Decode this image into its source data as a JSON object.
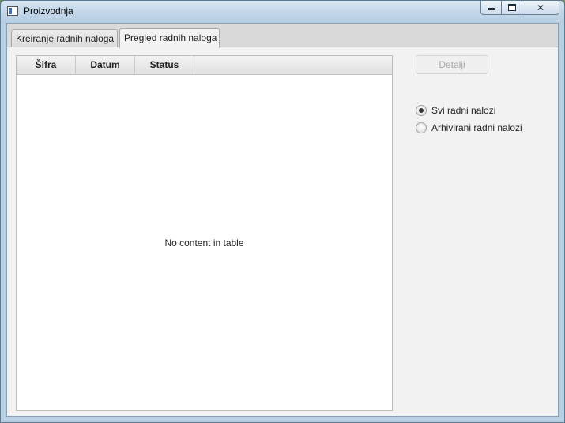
{
  "window": {
    "title": "Proizvodnja"
  },
  "tabs": [
    {
      "label": "Kreiranje radnih naloga",
      "selected": false
    },
    {
      "label": "Pregled radnih naloga",
      "selected": true
    }
  ],
  "table": {
    "columns": [
      "Šifra",
      "Datum",
      "Status"
    ],
    "rows": [],
    "empty_message": "No content in table"
  },
  "details_button": {
    "label": "Detalji",
    "enabled": false
  },
  "filter": {
    "options": [
      {
        "label": "Svi radni nalozi",
        "selected": true
      },
      {
        "label": "Arhivirani radni nalozi",
        "selected": false
      }
    ]
  },
  "colors": {
    "client_bg": "#f2f2f2",
    "tabstrip_bg": "#d9d9d9",
    "disabled_text": "#a8a8a8"
  }
}
